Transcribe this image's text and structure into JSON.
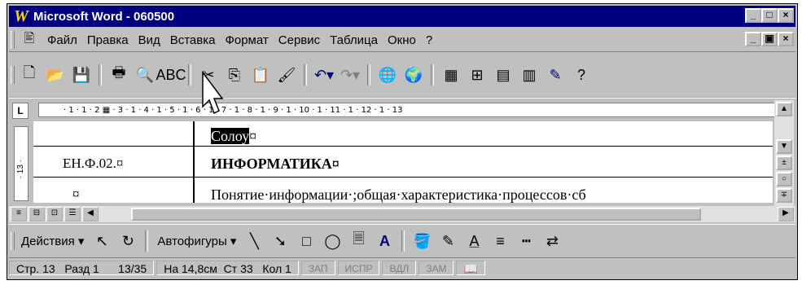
{
  "window": {
    "title": "Microsoft Word - 060500",
    "logo": "W",
    "controls": [
      "_",
      "□",
      "×"
    ]
  },
  "menu": {
    "items": [
      "Файл",
      "Правка",
      "Вид",
      "Вставка",
      "Формат",
      "Сервис",
      "Таблица",
      "Окно",
      "?"
    ],
    "doc_controls": [
      "_",
      "▣",
      "×"
    ]
  },
  "ruler": {
    "text": "· 1 · 1 · 2 ▦ · 3 · 1 · 4 · 1 · 5 · 1 · 6 · 1 · 7 · 1 · 8 · 1 · 9 · 1 · 10 · 1 · 11 · 1 · 12 · 1 · 13",
    "tab_button": "L"
  },
  "document": {
    "line1_selected": "Солоу",
    "line1_mark": "¤",
    "code": "ЕН.Ф.02.¤",
    "line2": "ИНФОРМАТИКА¤",
    "col_mark": "¤",
    "line3": "Понятие·информации·;общая·характеристика·процессов·сб",
    "vruler_label": "· 13 ·"
  },
  "drawbar": {
    "actions": "Действия ▾",
    "autoshapes": "Автофигуры ▾"
  },
  "status": {
    "page": "Стр. 13",
    "section": "Разд 1",
    "pages": "13/35",
    "at": "На 14,8см",
    "line": "Ст 33",
    "col": "Кол 1",
    "rec": "ЗАП",
    "trk": "ИСПР",
    "ext": "ВДЛ",
    "ovr": "ЗАМ"
  }
}
